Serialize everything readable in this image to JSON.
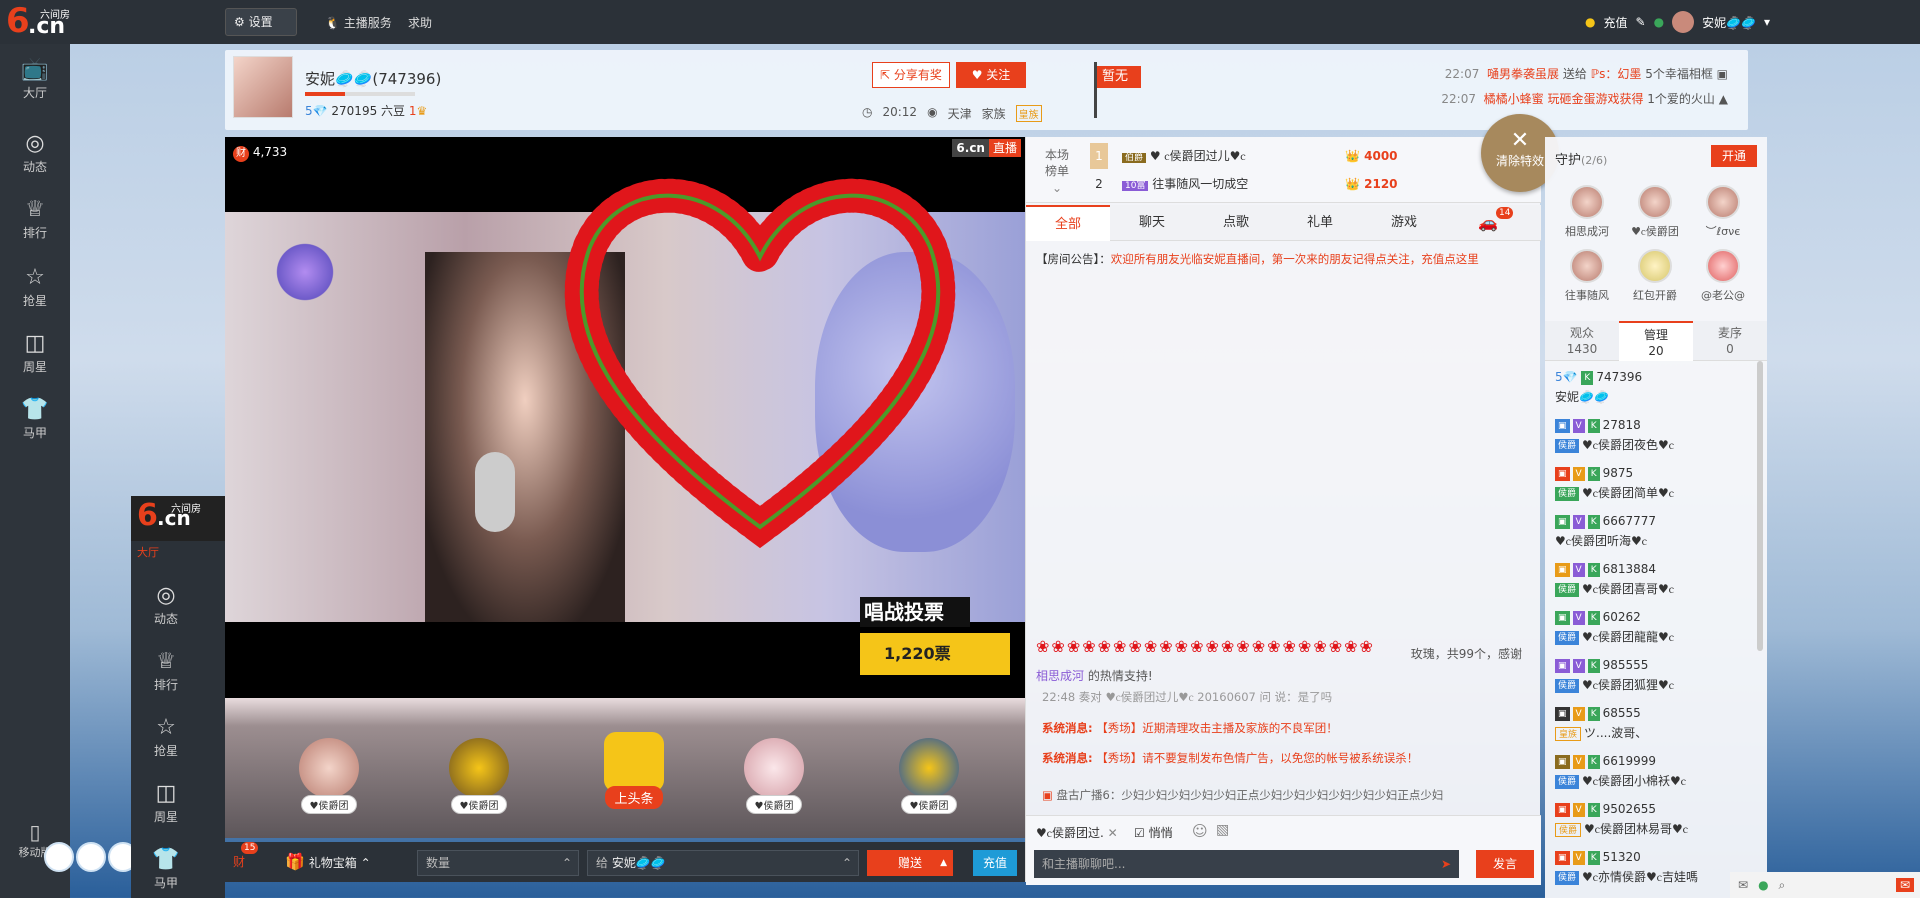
{
  "logo": {
    "text": "6.cn",
    "sub": "六间房"
  },
  "top": {
    "settings": "设置",
    "nav1": "主播服务",
    "nav2": "求助",
    "recharge": "充值",
    "user": "安妮🥏🥏"
  },
  "sidebar": {
    "items": [
      {
        "label": "大厅",
        "icon": "📺"
      },
      {
        "label": "动态",
        "icon": "◎"
      },
      {
        "label": "排行",
        "icon": "♕"
      },
      {
        "label": "抢星",
        "icon": "☆"
      },
      {
        "label": "周星",
        "icon": "◫"
      },
      {
        "label": "马甲",
        "icon": "👕"
      }
    ]
  },
  "anchor": {
    "name": "安妮🥏🥏(747396)",
    "level": "5💎",
    "beans": "270195 六豆",
    "fans": "1",
    "share": "分享有奖",
    "follow": "关注",
    "time": "20:12",
    "city": "天津",
    "family": "家族",
    "family_tag": "皇族",
    "flag": "暂无"
  },
  "broadcasts": [
    {
      "time": "22:07",
      "from": "嗵男拳袭虽展",
      "verb": "送给",
      "to": "ℙs：幻墨",
      "gift": "5个幸福相框"
    },
    {
      "time": "22:07",
      "from": "橘橘小蜂蜜",
      "verb": "玩砸金蛋游戏获得",
      "to": "",
      "gift": "1个爱的火山"
    }
  ],
  "video": {
    "wealth": "4,733",
    "brand": "6.cn",
    "live": "直播",
    "vote_title": "唱战投票",
    "vote_count": "1,220票"
  },
  "giftslots": [
    {
      "label": "♥侯爵团"
    },
    {
      "label": "♥侯爵团"
    },
    {
      "label": "上头条"
    },
    {
      "label": "♥侯爵团"
    },
    {
      "label": "♥侯爵团"
    }
  ],
  "giftbar": {
    "wealth_badge": "15",
    "wealth": "财",
    "chest": "礼物宝箱",
    "qty_placeholder": "数量",
    "to_label": "给",
    "to_user": "安妮🥏🥏",
    "send": "赠送",
    "pay": "充值"
  },
  "rank": {
    "label": "本场榜单",
    "rows": [
      {
        "n": "1",
        "name": "♥ ⲥ侯爵团过儿♥ⲥ",
        "val": "4000"
      },
      {
        "n": "2",
        "name": "往事随风一切成空",
        "val": "2120"
      }
    ]
  },
  "tabs": [
    {
      "label": "全部"
    },
    {
      "label": "聊天"
    },
    {
      "label": "点歌"
    },
    {
      "label": "礼单"
    },
    {
      "label": "游戏"
    }
  ],
  "car_count": "14",
  "notice": {
    "tag": "【房间公告】：",
    "text": "欢迎所有朋友光临安妮直播间，第一次来的朋友记得点关注，充值点这里"
  },
  "chat": {
    "rose_text": "玫瑰，共99个，感谢",
    "rose_user": "相思成河",
    "rose_tail": "的热情支持!",
    "line1": "22:48  奏对 ♥ⲥ侯爵团过儿♥ⲥ 20160607 问 说：是了吗",
    "sys1_tag": "系统消息:",
    "sys1": "【秀场】近期清理攻击主播及家族的不良军团！",
    "sys2_tag": "系统消息:",
    "sys2": "【秀场】请不要复制发布色情广告，以免您的帐号被系统误杀！",
    "bc": "盘古广播6：少妇少妇少妇少妇少妇正点少妇少妇少妇少妇少妇少妇正点少妇",
    "to": "♥ⲥ侯爵团过.",
    "whisper": "悄悄",
    "placeholder": "和主播聊聊吧...",
    "send": "发言"
  },
  "fx": {
    "label": "清除特效"
  },
  "guard": {
    "title": "守护",
    "count": "(2/6)",
    "open": "开通",
    "items": [
      {
        "name": "相思成河"
      },
      {
        "name": "♥ⲥ侯爵团"
      },
      {
        "name": "︶ℓσνє"
      },
      {
        "name": "往事随风"
      },
      {
        "name": "红包开爵"
      },
      {
        "name": "@老公@"
      }
    ]
  },
  "stabs": [
    {
      "label": "观众",
      "num": "1430"
    },
    {
      "label": "管理",
      "num": "20"
    },
    {
      "label": "麦序",
      "num": "0"
    }
  ],
  "users": [
    {
      "tag": "5💎",
      "id": "747396",
      "name": "安妮🥏🥏"
    },
    {
      "tag": "侯爵",
      "id": "27818",
      "name": "♥ⲥ侯爵团夜色♥ⲥ"
    },
    {
      "tag": "侯爵",
      "id": "9875",
      "name": "♥ⲥ侯爵团简单♥ⲥ"
    },
    {
      "tag": "侯爵",
      "id": "6667777",
      "name": "♥ⲥ侯爵团听海♥ⲥ"
    },
    {
      "tag": "侯爵",
      "id": "6813884",
      "name": "♥ⲥ侯爵团喜哥♥ⲥ"
    },
    {
      "tag": "侯爵",
      "id": "60262",
      "name": "♥ⲥ侯爵团龍龍♥ⲥ"
    },
    {
      "tag": "侯爵",
      "id": "985555",
      "name": "♥ⲥ侯爵团狐狸♥ⲥ"
    },
    {
      "tag": "皇族",
      "id": "68555",
      "name": "ツ....波哥、"
    },
    {
      "tag": "侯爵",
      "id": "6619999",
      "name": "♥ⲥ侯爵团小棉袄♥ⲥ"
    },
    {
      "tag": "侯爵",
      "id": "9502655",
      "name": "♥ⲥ侯爵团林易哥♥ⲥ"
    },
    {
      "tag": "侯爵",
      "id": "51320",
      "name": "♥ⲥ亦情侯爵♥ⲥ吉娃嗎"
    }
  ],
  "mobile": {
    "label": "移动版"
  },
  "colors": {
    "brand": "#e8401c",
    "dark": "#2b3138",
    "pay": "#1e9bd7"
  }
}
